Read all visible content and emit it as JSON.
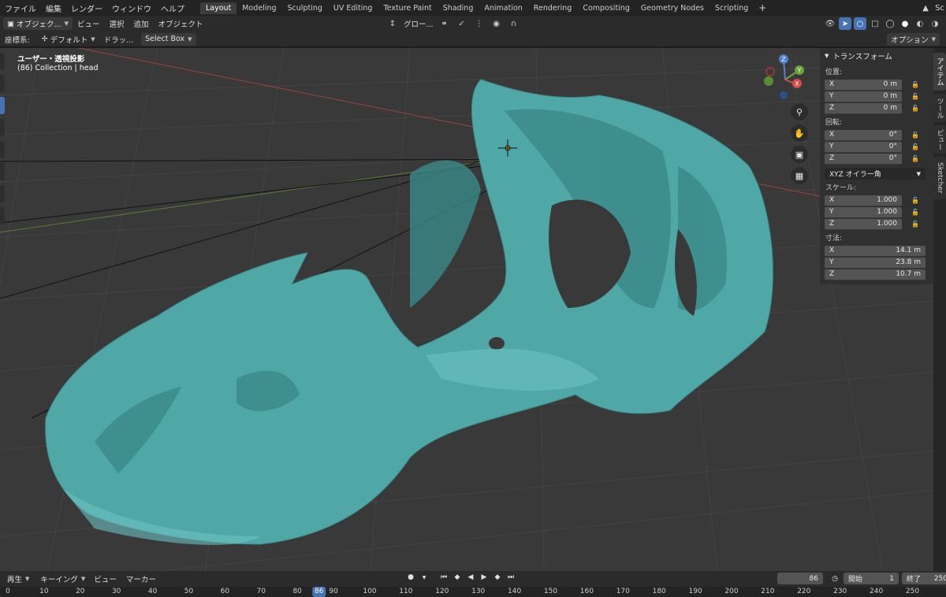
{
  "topbar": {
    "menus": [
      "ファイル",
      "編集",
      "レンダー",
      "ウィンドウ",
      "ヘルプ"
    ],
    "workspaces": [
      "Layout",
      "Modeling",
      "Sculpting",
      "UV Editing",
      "Texture Paint",
      "Shading",
      "Animation",
      "Rendering",
      "Compositing",
      "Geometry Nodes",
      "Scripting"
    ],
    "active_workspace": 0,
    "add_label": "+",
    "scene_label": "Sc"
  },
  "header": {
    "mode_label": "オブジェク...",
    "menus": [
      "ビュー",
      "選択",
      "追加",
      "オブジェクト"
    ],
    "transform_orientation": "グロー..."
  },
  "toolbar2": {
    "coord_label": "座標系:",
    "orientation": "デフォルト",
    "drag_label": "ドラッ...",
    "select_box": "Select Box",
    "options_label": "オプション"
  },
  "viewport": {
    "view_name": "ユーザー・透視投影",
    "collection_info": "(86) Collection | head",
    "gizmo": {
      "z": "Z",
      "y": "Y",
      "x": "X"
    }
  },
  "npanel": {
    "section_title": "トランスフォーム",
    "location_label": "位置:",
    "location": [
      {
        "axis": "X",
        "value": "0 m"
      },
      {
        "axis": "Y",
        "value": "0 m"
      },
      {
        "axis": "Z",
        "value": "0 m"
      }
    ],
    "rotation_label": "回転:",
    "rotation": [
      {
        "axis": "X",
        "value": "0°"
      },
      {
        "axis": "Y",
        "value": "0°"
      },
      {
        "axis": "Z",
        "value": "0°"
      }
    ],
    "rotation_mode": "XYZ オイラー角",
    "scale_label": "スケール:",
    "scale": [
      {
        "axis": "X",
        "value": "1.000"
      },
      {
        "axis": "Y",
        "value": "1.000"
      },
      {
        "axis": "Z",
        "value": "1.000"
      }
    ],
    "dimensions_label": "寸法:",
    "dimensions": [
      {
        "axis": "X",
        "value": "14.1 m"
      },
      {
        "axis": "Y",
        "value": "23.8 m"
      },
      {
        "axis": "Z",
        "value": "10.7 m"
      }
    ]
  },
  "sidetabs": [
    "アイテム",
    "ツール",
    "ビュー",
    "Sketcher"
  ],
  "timeline": {
    "playback_label": "再生",
    "keying_label": "キーイング",
    "view_label": "ビュー",
    "marker_label": "マーカー",
    "current_frame": "86",
    "start_label": "開始",
    "start_value": "1",
    "end_label": "終了",
    "end_value": "250",
    "ruler_ticks": [
      "0",
      "10",
      "20",
      "30",
      "40",
      "50",
      "60",
      "70",
      "80",
      "90",
      "100",
      "110",
      "120",
      "130",
      "140",
      "150",
      "160",
      "170",
      "180",
      "190",
      "200",
      "210",
      "220",
      "230",
      "240",
      "250"
    ]
  },
  "colors": {
    "mesh": "#4fa7a6",
    "accent": "#4772b3",
    "x_axis": "#d94a4a",
    "y_axis": "#6da33a"
  }
}
